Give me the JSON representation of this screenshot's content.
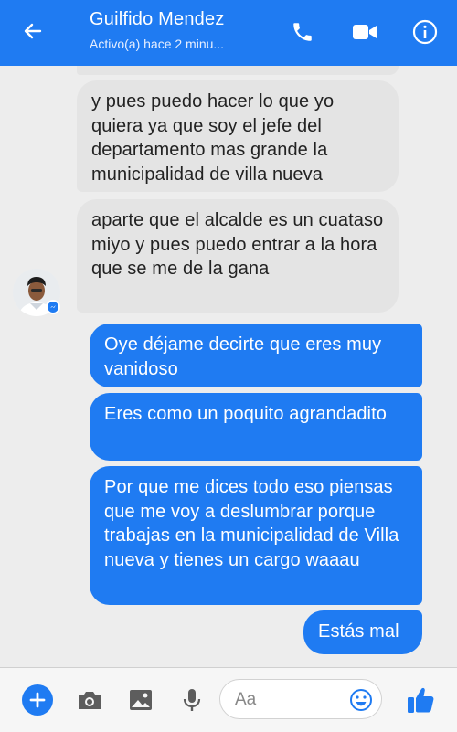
{
  "header": {
    "contact_name": "Guilfido Mendez",
    "status": "Activo(a) hace 2 minu..."
  },
  "messages": [
    {
      "direction": "incoming",
      "text": "y pues puedo hacer lo que yo quiera ya que soy el jefe del departamento mas grande la municipalidad de villa nueva"
    },
    {
      "direction": "incoming",
      "text": "aparte que el alcalde es un cuataso miyo y pues puedo entrar a la hora que se me de la gana"
    },
    {
      "direction": "outgoing",
      "text": "Oye déjame decirte que eres muy vanidoso"
    },
    {
      "direction": "outgoing",
      "text": "Eres como un poquito agrandadito"
    },
    {
      "direction": "outgoing",
      "text": "Por que me dices todo eso piensas que me voy a deslumbrar porque trabajas en la municipalidad de Villa nueva y tienes un cargo waaau"
    },
    {
      "direction": "outgoing",
      "text": "Estás mal"
    }
  ],
  "composer": {
    "placeholder": "Aa"
  },
  "icons": {
    "back": "back-arrow-icon",
    "call": "phone-icon",
    "video": "video-camera-icon",
    "info": "info-icon",
    "plus": "plus-icon",
    "camera": "camera-icon",
    "image": "image-icon",
    "mic": "microphone-icon",
    "emoji": "emoji-icon",
    "like": "thumbs-up-icon"
  },
  "colors": {
    "brand": "#1f7bf2",
    "incoming_bubble": "#e4e4e4",
    "background": "#ededed"
  }
}
